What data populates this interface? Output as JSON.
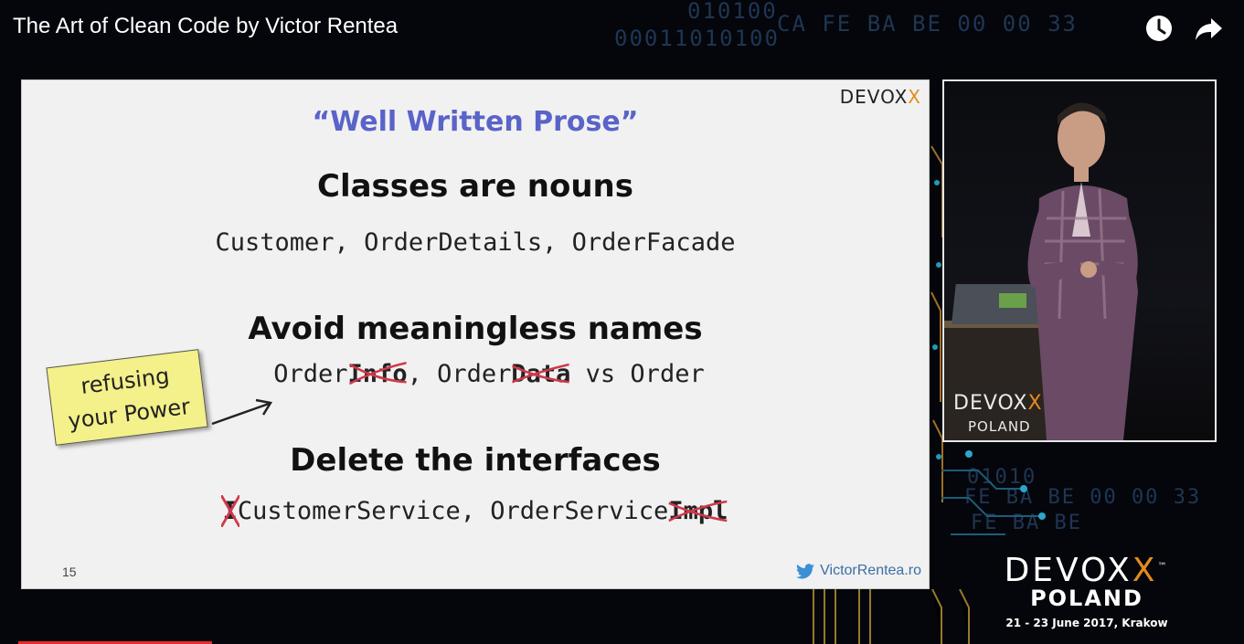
{
  "video": {
    "title": "The Art of Clean Code by Victor Rentea",
    "watch_later_icon": "clock-icon",
    "share_icon": "share-icon",
    "progress_color": "#e52d27",
    "progress_fraction": 0.15
  },
  "background": {
    "hex_lines": [
      "010100",
      "00011010100",
      "CA FE BA BE 00 00 33",
      "01010",
      "FE BA BE 00 00 33",
      "FE BA BE"
    ]
  },
  "slide": {
    "quote": "“Well Written Prose”",
    "section1_heading": "Classes are nouns",
    "section1_code": "Customer, OrderDetails, OrderFacade",
    "section2_heading": "Avoid meaningless names",
    "section2_code": {
      "part1": "Order",
      "struck1": "Info",
      "part2": ", Order",
      "struck2": "Data",
      "part3": " vs Order"
    },
    "section3_heading": "Delete the interfaces",
    "section3_code": {
      "struck1": "I",
      "part1": "CustomerService, OrderService",
      "struck2": "Impl"
    },
    "note_line1": "refusing",
    "note_line2": "your Power",
    "logo_text": "DEVOX",
    "logo_x": "X",
    "page_number": "15",
    "twitter_handle": "VictorRentea.ro",
    "quote_color": "#5a63c9",
    "strike_color": "#d0384a",
    "note_color": "#f4f08a"
  },
  "speaker_video": {
    "stage_logo": "DEVOX",
    "stage_logo_x": "X",
    "stage_poland": "POLAND"
  },
  "event": {
    "logo": "DEVOX",
    "logo_x": "X",
    "tm": "™",
    "location": "POLAND",
    "dates": "21 - 23 June 2017, Krakow",
    "accent_color": "#e38c1c"
  }
}
